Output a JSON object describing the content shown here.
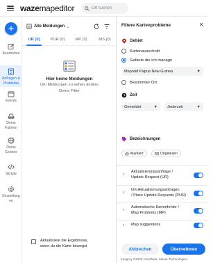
{
  "app": {
    "logo_main": "waze",
    "logo_thin": "mapeditor"
  },
  "search": {
    "placeholder": "Ort suchen"
  },
  "nav": {
    "items": [
      {
        "label": "Bearbeiten",
        "icon": "edit-icon"
      },
      {
        "label": "Anfragen & Probleme",
        "icon": "requests-icon",
        "active": true
      },
      {
        "label": "Events",
        "icon": "calendar-icon"
      },
      {
        "label": "Deine Fahrten",
        "icon": "car-icon"
      },
      {
        "label": "Deine Gebiete",
        "icon": "globe-icon"
      },
      {
        "label": "Skripte",
        "icon": "code-icon"
      },
      {
        "label": "Einstellungen",
        "icon": "settings-icon"
      }
    ]
  },
  "issues": {
    "dropdown_label": "Alle Meldungen",
    "tabs": [
      "UR (0)",
      "PUR (0)",
      "MP (0)",
      "MS (0)"
    ],
    "empty_title": "Hier keine Meldungen",
    "empty_sub_1": "Um Meldungen zu sehen ändere",
    "empty_sub_2": "Deine Filter",
    "refresh_1": "Aktualisiere die Ergebnisse,",
    "refresh_2": "wenn du die Karte bewegst"
  },
  "filter": {
    "title": "Filtere Kartenprobleme",
    "area": {
      "heading": "Gebiet",
      "options": [
        "Kartenausschnitt",
        "Gebiete die ich manage",
        "Bestimmter Ort"
      ],
      "selected_index": 1,
      "managed_area": "Mapraid Papua New Guinea"
    },
    "time": {
      "heading": "Zeit",
      "type": "Gemeldet",
      "range": "Jederzeit"
    },
    "labels": {
      "heading": "Bezeichnungen",
      "chips": [
        "Markiert",
        "Ungelesen"
      ]
    },
    "types": [
      {
        "line1": "Aktualisierungsanfrage /",
        "line2": "Update Request (UR)",
        "enabled": true
      },
      {
        "line1": "Ort-Aktualisierungsanfragen",
        "line2": "/ Place Update Requests (PUR)",
        "enabled": true
      },
      {
        "line1": "Automatische Kartenfehler /",
        "line2": "Map Problems (MP)",
        "enabled": true
      },
      {
        "line1": "Map suggestions",
        "line2": "",
        "enabled": true
      }
    ],
    "cancel": "Abbrechen",
    "apply": "Übernehmen"
  },
  "footer": {
    "imagery": "Imagery ©2025 AeroWest, Maxar Technologies"
  },
  "colors": {
    "accent": "#1a73e8",
    "area_icon": "#b3261e",
    "time_icon": "#202124",
    "label_icon": "#9c27b0"
  }
}
